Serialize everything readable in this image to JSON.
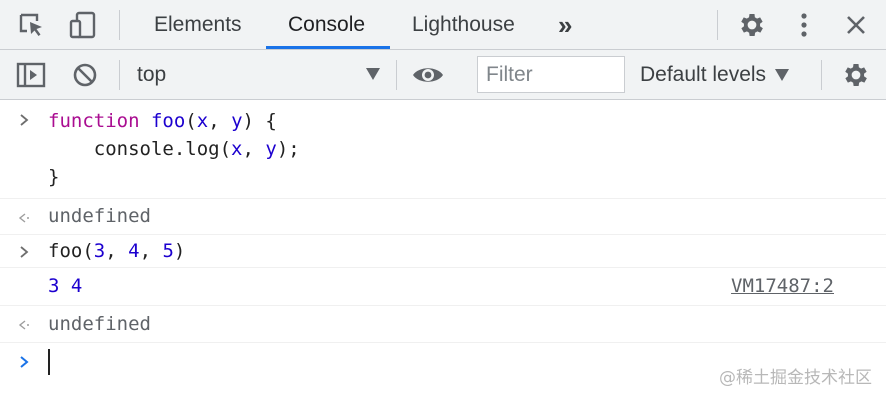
{
  "tabs": [
    {
      "label": "Elements"
    },
    {
      "label": "Console"
    },
    {
      "label": "Lighthouse"
    }
  ],
  "more_tabs_glyph": "»",
  "toolbar": {
    "context": "top",
    "filter_placeholder": "Filter",
    "levels": "Default levels"
  },
  "console": {
    "input1": {
      "kw": "function",
      "name": "foo",
      "open": "(",
      "p1": "x",
      "comma": ", ",
      "p2": "y",
      "close": ") {",
      "line2_a": "    console.log(",
      "line2_x": "x",
      "line2_sep": ", ",
      "line2_y": "y",
      "line2_end": ");",
      "line3": "}"
    },
    "result1": "undefined",
    "input2": {
      "prefix": "foo(",
      "a": "3",
      "sep1": ", ",
      "b": "4",
      "sep2": ", ",
      "c": "5",
      "suffix": ")"
    },
    "log_output": "3 4",
    "log_source": "VM17487:2",
    "result2": "undefined"
  },
  "watermark": "@稀土掘金技术社区",
  "colors": {
    "accent": "#1a73e8",
    "keyword": "#aa0d91",
    "number": "#1c00cf"
  },
  "icons": [
    "inspect-element-icon",
    "device-toolbar-icon",
    "settings-gear-icon",
    "more-vertical-icon",
    "close-icon",
    "sidebar-toggle-icon",
    "clear-console-icon",
    "eye-icon",
    "console-settings-gear-icon",
    "input-chevron-icon",
    "result-arrow-icon",
    "prompt-chevron-icon"
  ]
}
